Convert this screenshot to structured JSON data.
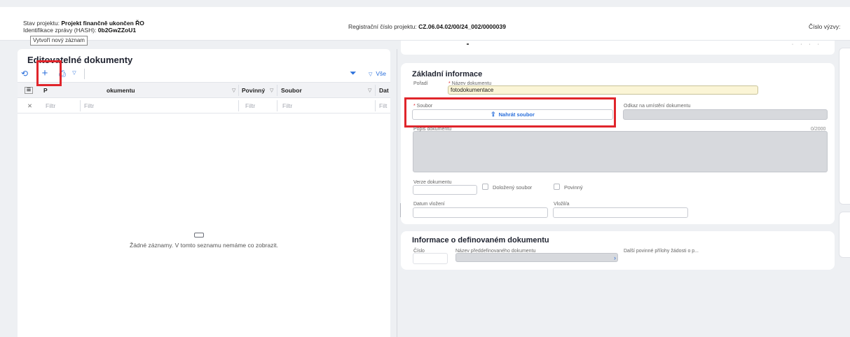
{
  "header": {
    "project_state_label": "Stav projektu:",
    "project_state_value": "Projekt finančně ukončen ŘO",
    "hash_label": "Identifikace zprávy (HASH):",
    "hash_value": "0b2GwZZoU1",
    "reg_label": "Registrační číslo projektu:",
    "reg_value": "CZ.06.04.02/00/24_002/0000039",
    "call_label": "Číslo výzvy:"
  },
  "left_panel": {
    "title": "Editovatelné dokumenty",
    "toolbar": {
      "refresh_icon": "refresh-icon",
      "add_icon": "plus-icon",
      "print_icon": "print-icon",
      "filter_icon": "funnel-icon",
      "all_label": "Vše",
      "add_tooltip": "Vytvoří nový záznam"
    },
    "columns": [
      "P",
      "Název dokumentu",
      "Povinný",
      "Soubor",
      "Dat"
    ],
    "column_name_partial": "okumentu",
    "filter_placeholder": "Filtr",
    "filter_partial": "Filt",
    "empty_text": "Žádné záznamy. V tomto seznamu nemáme co zobrazit."
  },
  "basic_info": {
    "title": "Základní informace",
    "order_label": "Pořadí",
    "name_label": "Název dokumentu",
    "name_value": "fotodokumentace",
    "file_label": "Soubor",
    "upload_label": "Nahrát soubor",
    "location_label": "Odkaz na umístění dokumentu",
    "description_label": "Popis dokumentu",
    "description_counter": "0/2000",
    "version_label": "Verze dokumentu",
    "proven_file_label": "Doložený soubor",
    "mandatory_label": "Povinný",
    "insert_date_label": "Datum vložení",
    "inserted_by_label": "Vložil/a"
  },
  "defined_doc": {
    "title": "Informace o definovaném dokumentu",
    "number_label": "Číslo",
    "predefined_name_label": "Název předdefinovaného dokumentu",
    "other_attachments_label": "Další povinné přílohy žádosti o p..."
  },
  "colors": {
    "accent": "#2a6fdb",
    "highlight": "#e0252b",
    "required_field": "#fbf5d6"
  }
}
